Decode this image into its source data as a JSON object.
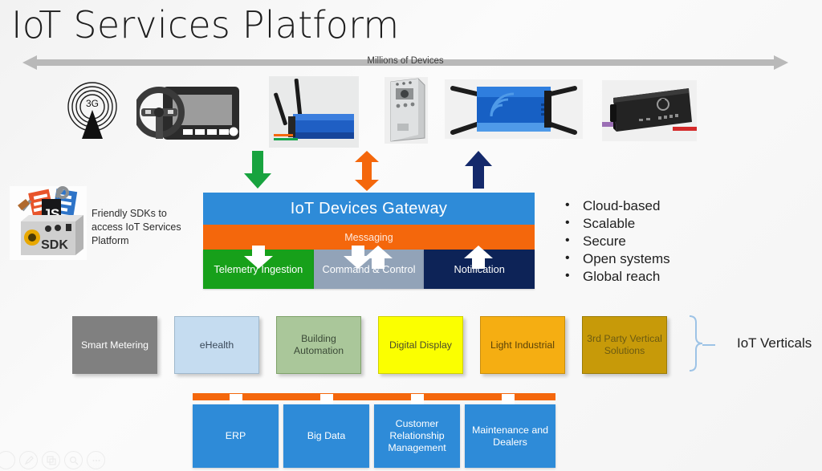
{
  "slide": {
    "title": "IoT Services Platform",
    "device_band": {
      "label": "Millions of Devices",
      "color": "#b4b4b4"
    },
    "devices": [
      {
        "name": "cell-tower-3g",
        "label": "3G"
      },
      {
        "name": "connected-car-dashboard",
        "label": ""
      },
      {
        "name": "blue-router-antennas",
        "label": ""
      },
      {
        "name": "wall-mounted-meter",
        "label": ""
      },
      {
        "name": "blue-industrial-gateway",
        "label": ""
      },
      {
        "name": "black-broadband-router",
        "label": ""
      }
    ],
    "flow_arrows": [
      {
        "name": "telemetry-down-arrow",
        "direction": "down",
        "color": "#18a33f"
      },
      {
        "name": "command-bidirectional-arrow",
        "direction": "both",
        "color": "#f4670c"
      },
      {
        "name": "notification-up-arrow",
        "direction": "up",
        "color": "#14296b"
      }
    ],
    "gateway": {
      "title": "IoT Devices Gateway",
      "title_color": "#2e8bd8",
      "messaging": "Messaging",
      "messaging_color": "#f4670c",
      "boxes": [
        {
          "label": "Telemetry Ingestion",
          "color": "#17a01a"
        },
        {
          "label": "Command & Control",
          "color": "#92a3b8"
        },
        {
          "label": "Notification",
          "color": "#0d2357"
        }
      ]
    },
    "sdk": {
      "badge": "SDK",
      "js_tile": "JS",
      "caption": "Friendly SDKs to access IoT Services Platform"
    },
    "features": [
      "Cloud-based",
      "Scalable",
      "Secure",
      "Open systems",
      "Global reach"
    ],
    "verticals": {
      "label": "IoT Verticals",
      "brace_color": "#9dc3e6",
      "items": [
        {
          "label": "Smart Metering",
          "bg": "#808080",
          "fg": "#ffffff",
          "border": "#808080"
        },
        {
          "label": "eHealth",
          "bg": "#c5dcf0",
          "fg": "#3b4a5a",
          "border": "#9fb8cc"
        },
        {
          "label": "Building Automation",
          "bg": "#aac79a",
          "fg": "#3b4a37",
          "border": "#7fa36a"
        },
        {
          "label": "Digital Display",
          "bg": "#fbff00",
          "fg": "#4a4a2a",
          "border": "#cfd000"
        },
        {
          "label": "Light Industrial",
          "bg": "#f5ae12",
          "fg": "#5a4208",
          "border": "#c98e0c"
        },
        {
          "label": "3rd Party Vertical Solutions",
          "bg": "#c79a09",
          "fg": "#6b5a12",
          "border": "#9b7c07"
        }
      ]
    },
    "business_systems": {
      "bar_color": "#f4670c",
      "items": [
        "ERP",
        "Big Data",
        "Customer Relationship Management",
        "Maintenance and Dealers"
      ]
    },
    "watermark_icons": [
      "pen-icon",
      "copy-icon",
      "search-icon",
      "more-icon"
    ]
  }
}
